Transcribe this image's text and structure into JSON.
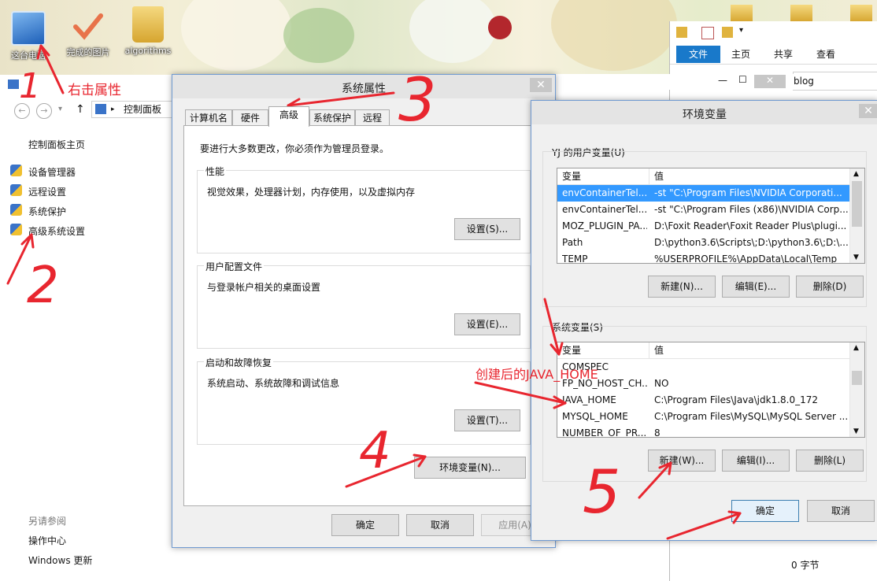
{
  "desktop": {
    "icons": [
      {
        "label": "这台电脑",
        "icon": "computer-icon"
      },
      {
        "label": "完成的图片",
        "icon": "checkmark-icon"
      },
      {
        "label": "algorithms",
        "icon": "folder-icon"
      }
    ]
  },
  "annotations": {
    "right_click_props": "右击属性",
    "java_home_created": "创建后的JAVA_HOME",
    "step1": "1",
    "step2": "2",
    "step3": "3",
    "step4": "4",
    "step5": "5"
  },
  "control_panel": {
    "breadcrumb": "控制面板",
    "home_link": "控制面板主页",
    "links": [
      "设备管理器",
      "远程设置",
      "系统保护",
      "高级系统设置"
    ],
    "see_also_heading": "另请参阅",
    "see_also_links": [
      "操作中心",
      "Windows 更新"
    ]
  },
  "explorer": {
    "tabs": [
      "文件",
      "主页",
      "共享",
      "查看"
    ],
    "address_fragment": "blog",
    "status_text": "0 字节"
  },
  "system_properties": {
    "title": "系统属性",
    "tabs": [
      "计算机名",
      "硬件",
      "高级",
      "系统保护",
      "远程"
    ],
    "admin_note": "要进行大多数更改，你必须作为管理员登录。",
    "performance": {
      "label": "性能",
      "desc": "视觉效果，处理器计划，内存使用，以及虚拟内存",
      "button": "设置(S)..."
    },
    "user_profiles": {
      "label": "用户配置文件",
      "desc": "与登录帐户相关的桌面设置",
      "button": "设置(E)..."
    },
    "startup_recovery": {
      "label": "启动和故障恢复",
      "desc": "系统启动、系统故障和调试信息",
      "button": "设置(T)..."
    },
    "env_button": "环境变量(N)...",
    "ok": "确定",
    "cancel": "取消",
    "apply": "应用(A)"
  },
  "env_vars": {
    "title": "环境变量",
    "user_section": "YJ 的用户变量(U)",
    "col_var": "变量",
    "col_val": "值",
    "user_rows": [
      {
        "name": "envContainerTel...",
        "value": "-st \"C:\\Program Files\\NVIDIA Corporati..."
      },
      {
        "name": "envContainerTel...",
        "value": "-st \"C:\\Program Files (x86)\\NVIDIA Corp..."
      },
      {
        "name": "MOZ_PLUGIN_PA...",
        "value": "D:\\Foxit Reader\\Foxit Reader Plus\\plugi..."
      },
      {
        "name": "Path",
        "value": "D:\\python3.6\\Scripts\\;D:\\python3.6\\;D:\\..."
      },
      {
        "name": "TEMP",
        "value": "%USERPROFILE%\\AppData\\Local\\Temp"
      }
    ],
    "user_buttons": {
      "new": "新建(N)...",
      "edit": "编辑(E)...",
      "delete": "删除(D)"
    },
    "system_section": "系统变量(S)",
    "system_rows": [
      {
        "name": "COMSPEC",
        "value": ""
      },
      {
        "name": "FP_NO_HOST_CH...",
        "value": "NO"
      },
      {
        "name": "JAVA_HOME",
        "value": "C:\\Program Files\\Java\\jdk1.8.0_172"
      },
      {
        "name": "MYSQL_HOME",
        "value": "C:\\Program Files\\MySQL\\MySQL Server ..."
      },
      {
        "name": "NUMBER_OF_PR...",
        "value": "8"
      }
    ],
    "system_buttons": {
      "new": "新建(W)...",
      "edit": "编辑(I)...",
      "delete": "删除(L)"
    },
    "ok": "确定",
    "cancel": "取消"
  }
}
